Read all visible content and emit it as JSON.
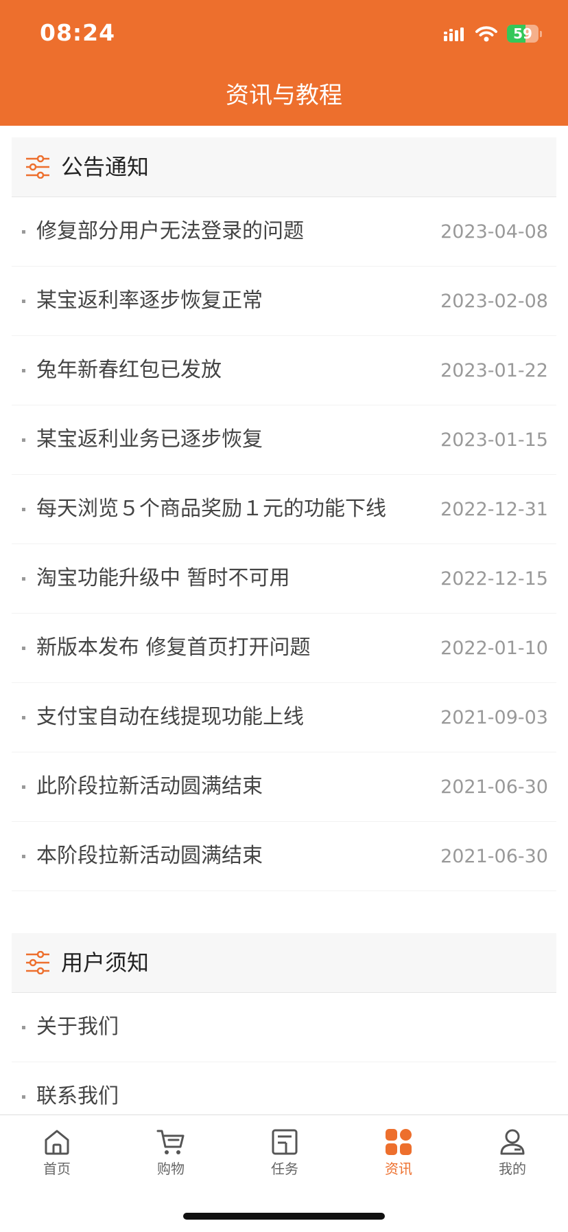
{
  "status_bar": {
    "time": "08:24",
    "battery_level": "59",
    "battery_fraction": 0.59
  },
  "header": {
    "title": "资讯与教程"
  },
  "announcements": {
    "title": "公告通知",
    "icon": "filter-icon",
    "items": [
      {
        "title": "修复部分用户无法登录的问题",
        "date": "2023-04-08"
      },
      {
        "title": "某宝返利率逐步恢复正常",
        "date": "2023-02-08"
      },
      {
        "title": "兔年新春红包已发放",
        "date": "2023-01-22"
      },
      {
        "title": "某宝返利业务已逐步恢复",
        "date": "2023-01-15"
      },
      {
        "title": "每天浏览５个商品奖励１元的功能下线",
        "date": "2022-12-31"
      },
      {
        "title": "淘宝功能升级中 暂时不可用",
        "date": "2022-12-15"
      },
      {
        "title": "新版本发布 修复首页打开问题",
        "date": "2022-01-10"
      },
      {
        "title": "支付宝自动在线提现功能上线",
        "date": "2021-09-03"
      },
      {
        "title": "此阶段拉新活动圆满结束",
        "date": "2021-06-30"
      },
      {
        "title": "本阶段拉新活动圆满结束",
        "date": "2021-06-30"
      }
    ]
  },
  "user_notice": {
    "title": "用户须知",
    "icon": "filter-icon",
    "items": [
      {
        "title": "关于我们"
      },
      {
        "title": "联系我们"
      }
    ]
  },
  "tabbar": {
    "tabs": [
      {
        "label": "首页",
        "icon": "home-icon",
        "active": false
      },
      {
        "label": "购物",
        "icon": "cart-icon",
        "active": false
      },
      {
        "label": "任务",
        "icon": "task-icon",
        "active": false
      },
      {
        "label": "资讯",
        "icon": "grid-icon",
        "active": true
      },
      {
        "label": "我的",
        "icon": "profile-icon",
        "active": false
      }
    ]
  },
  "colors": {
    "brand": "#ED6F2D",
    "battery": "#34C759",
    "inactive_tab": "#666666",
    "date_text": "#999999"
  }
}
